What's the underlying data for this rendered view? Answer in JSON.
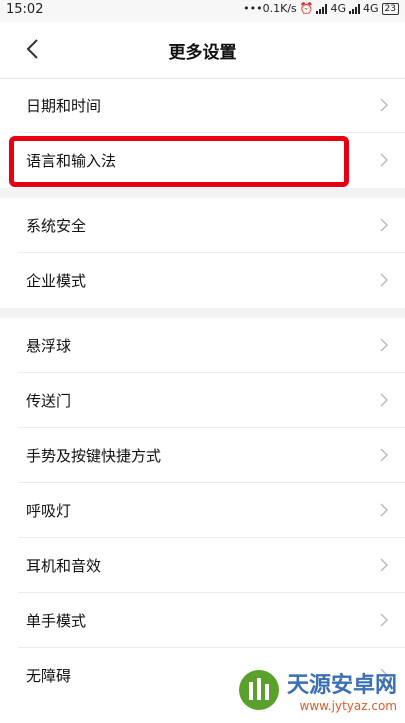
{
  "status": {
    "time": "15:02",
    "speed": "•••0.1K/s",
    "net1": "4G",
    "net2": "4G",
    "battery": "23"
  },
  "header": {
    "title": "更多设置"
  },
  "groups": [
    [
      "日期和时间",
      "语言和输入法"
    ],
    [
      "系统安全",
      "企业模式"
    ],
    [
      "悬浮球",
      "传送门",
      "手势及按键快捷方式",
      "呼吸灯",
      "耳机和音效",
      "单手模式",
      "无障碍"
    ]
  ],
  "watermark": {
    "title": "天源安卓网",
    "url": "www.jytyaz.com"
  },
  "colors": {
    "highlight": "#e60012",
    "background": "#f3f3f3"
  }
}
